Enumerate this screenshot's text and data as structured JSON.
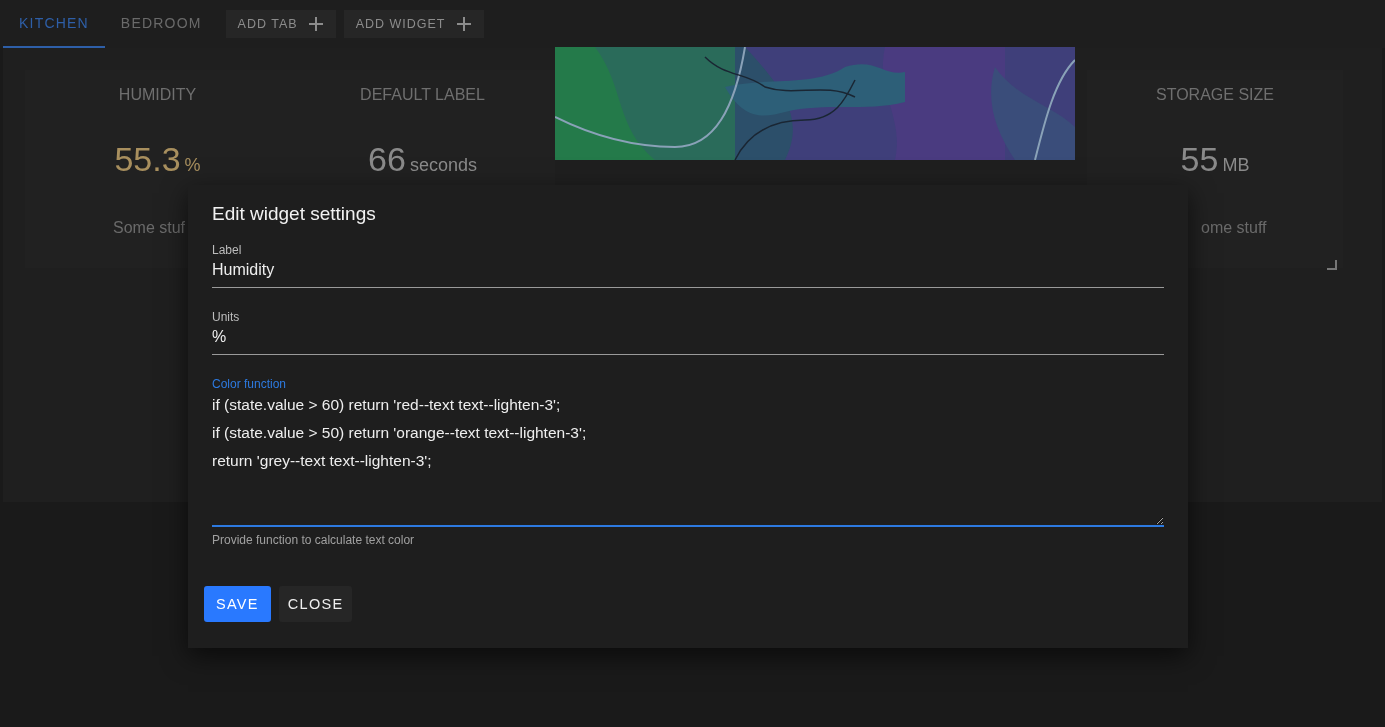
{
  "tabs": [
    {
      "label": "KITCHEN",
      "selected": true
    },
    {
      "label": "BEDROOM",
      "selected": false
    }
  ],
  "toolbar_buttons": [
    {
      "label": "ADD TAB"
    },
    {
      "label": "ADD WIDGET"
    }
  ],
  "widgets": [
    {
      "kind": "value",
      "title": "HUMIDITY",
      "value": "55.3",
      "unit": "%",
      "color": "#a88f5e",
      "footer": "Some stuf"
    },
    {
      "kind": "value",
      "title": "DEFAULT LABEL",
      "value": "66",
      "unit": "seconds",
      "color": "#8a8a8a"
    },
    {
      "kind": "picture"
    },
    {
      "kind": "value",
      "title": "STORAGE SIZE",
      "value": "55",
      "unit": "MB",
      "color": "#8a8a8a",
      "footer": "ome stuff",
      "resizable": true
    }
  ],
  "dialog": {
    "title": "Edit widget settings",
    "fields": [
      {
        "label": "Label",
        "value": "Humidity",
        "focused": false
      },
      {
        "label": "Units",
        "value": "%",
        "focused": false
      },
      {
        "label": "Color function",
        "value": "if (state.value > 60) return 'red--text text--lighten-3';\nif (state.value > 50) return 'orange--text text--lighten-3';\nreturn 'grey--text text--lighten-3';",
        "hint": "Provide function to calculate text color",
        "kind": "textarea",
        "focused": true
      }
    ],
    "buttons": [
      {
        "label": "SAVE",
        "kind": "primary"
      },
      {
        "label": "CLOSE",
        "kind": "default"
      }
    ]
  }
}
